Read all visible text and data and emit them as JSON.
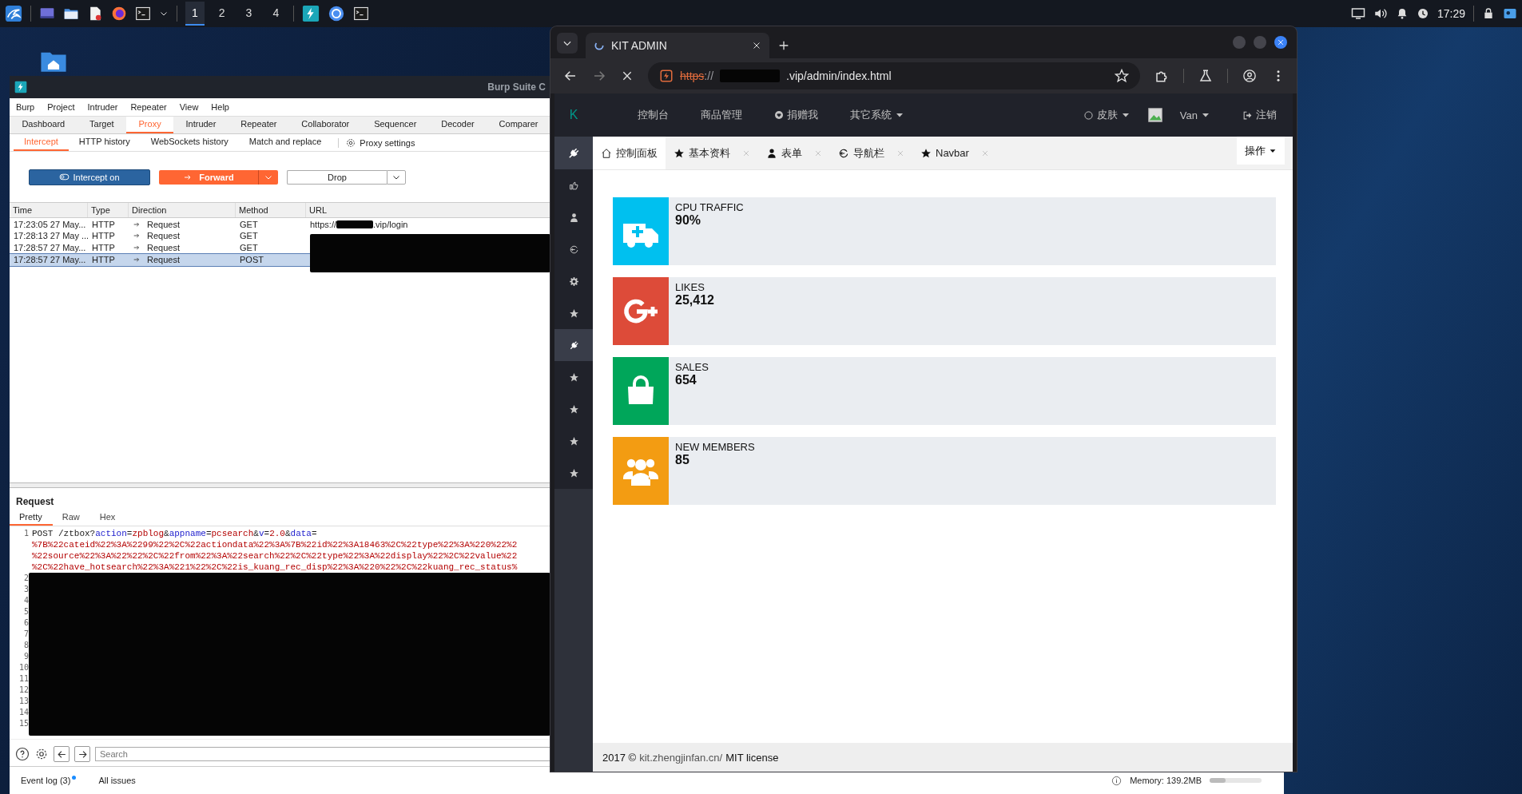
{
  "taskbar": {
    "workspaces": [
      {
        "label": "1",
        "selected": true
      },
      {
        "label": "2",
        "selected": false
      },
      {
        "label": "3",
        "selected": false
      },
      {
        "label": "4",
        "selected": false
      }
    ],
    "clock": "17:29"
  },
  "burp": {
    "title": "Burp Suite C",
    "menu": [
      "Burp",
      "Project",
      "Intruder",
      "Repeater",
      "View",
      "Help"
    ],
    "tools": [
      {
        "label": "Dashboard",
        "selected": false
      },
      {
        "label": "Target",
        "selected": false
      },
      {
        "label": "Proxy",
        "selected": true
      },
      {
        "label": "Intruder",
        "selected": false
      },
      {
        "label": "Repeater",
        "selected": false
      },
      {
        "label": "Collaborator",
        "selected": false
      },
      {
        "label": "Sequencer",
        "selected": false
      },
      {
        "label": "Decoder",
        "selected": false
      },
      {
        "label": "Comparer",
        "selected": false
      }
    ],
    "proxy_tabs": [
      {
        "label": "Intercept",
        "selected": true
      },
      {
        "label": "HTTP history",
        "selected": false
      },
      {
        "label": "WebSockets history",
        "selected": false
      },
      {
        "label": "Match and replace",
        "selected": false
      }
    ],
    "proxy_settings": "Proxy settings",
    "intercept_button": "Intercept on",
    "forward_button": "Forward",
    "drop_button": "Drop",
    "table": {
      "columns": [
        "Time",
        "Type",
        "Direction",
        "Method",
        "URL"
      ],
      "rows": [
        {
          "time": "17:23:05 27 May...",
          "type": "HTTP",
          "direction": "Request",
          "method": "GET",
          "url_prefix": "https://",
          "url_suffix": ".vip/login",
          "selected": false
        },
        {
          "time": "17:28:13 27 May ...",
          "type": "HTTP",
          "direction": "Request",
          "method": "GET",
          "selected": false
        },
        {
          "time": "17:28:57 27 May...",
          "type": "HTTP",
          "direction": "Request",
          "method": "GET",
          "selected": false
        },
        {
          "time": "17:28:57 27 May...",
          "type": "HTTP",
          "direction": "Request",
          "method": "POST",
          "selected": true
        }
      ]
    },
    "request": {
      "title": "Request",
      "tabs": [
        {
          "label": "Pretty",
          "selected": true
        },
        {
          "label": "Raw",
          "selected": false
        },
        {
          "label": "Hex",
          "selected": false
        }
      ],
      "first_line": {
        "number": "1",
        "segments": [
          {
            "text": "POST /ztbox?",
            "kind": "plain"
          },
          {
            "text": "action",
            "kind": "name"
          },
          {
            "text": "=",
            "kind": "plain"
          },
          {
            "text": "zpblog",
            "kind": "value"
          },
          {
            "text": "&",
            "kind": "plain"
          },
          {
            "text": "appname",
            "kind": "name"
          },
          {
            "text": "=",
            "kind": "plain"
          },
          {
            "text": "pcsearch",
            "kind": "value"
          },
          {
            "text": "&",
            "kind": "plain"
          },
          {
            "text": "v",
            "kind": "name"
          },
          {
            "text": "=",
            "kind": "plain"
          },
          {
            "text": "2.0",
            "kind": "value"
          },
          {
            "text": "&",
            "kind": "plain"
          },
          {
            "text": "data",
            "kind": "name"
          },
          {
            "text": "=",
            "kind": "plain"
          }
        ],
        "continuation": [
          "%7B%22cateid%22%3A%2299%22%2C%22actiondata%22%3A%7B%22id%22%3A18463%2C%22type%22%3A%220%22%2",
          "%22source%22%3A%22%22%2C%22from%22%3A%22search%22%2C%22type%22%3A%22display%22%2C%22value%22",
          "%2C%22have_hotsearch%22%3A%221%22%2C%22is_kuang_rec_disp%22%3A%220%22%2C%22kuang_rec_status%"
        ]
      },
      "line_numbers": [
        "2",
        "3",
        "4",
        "5",
        "6",
        "7",
        "8",
        "9",
        "10",
        "11",
        "12",
        "13",
        "14",
        "15"
      ],
      "search_placeholder": "Search"
    },
    "status": {
      "event_log": "Event log (3)",
      "all_issues": "All issues",
      "memory": {
        "label": "Memory: 139.2MB",
        "level": 0.3
      }
    }
  },
  "browser": {
    "tab_title": "KIT ADMIN",
    "url_scheme": "https",
    "url_separator": "://",
    "url_suffix": ".vip/admin/index.html",
    "app": {
      "logo": "K",
      "nav": [
        {
          "label": "控制台",
          "kind": "link"
        },
        {
          "label": "商品管理",
          "kind": "link"
        },
        {
          "label": "捐赠我",
          "kind": "heart"
        },
        {
          "label": "其它系统",
          "kind": "dropdown"
        }
      ],
      "skin": "皮肤",
      "user": "Van",
      "logout": "注销",
      "tabs": [
        {
          "label": "控制面板",
          "kind": "home",
          "selected": true,
          "closable": false
        },
        {
          "label": "基本资料",
          "kind": "star",
          "selected": false,
          "closable": true
        },
        {
          "label": "表单",
          "kind": "user",
          "selected": false,
          "closable": true
        },
        {
          "label": "导航栏",
          "kind": "refresh",
          "selected": false,
          "closable": true
        },
        {
          "label": "Navbar",
          "kind": "star",
          "selected": false,
          "closable": true
        }
      ],
      "actions": "操作",
      "sidebar": [
        {
          "kind": "thumbs-up",
          "selected": false
        },
        {
          "kind": "user",
          "selected": false
        },
        {
          "kind": "refresh",
          "selected": false
        },
        {
          "kind": "gear",
          "selected": false
        },
        {
          "kind": "star",
          "selected": false
        },
        {
          "kind": "plug",
          "selected": true
        },
        {
          "kind": "star",
          "selected": false
        },
        {
          "kind": "star",
          "selected": false
        },
        {
          "kind": "star",
          "selected": false
        },
        {
          "kind": "star",
          "selected": false
        }
      ],
      "cards": [
        {
          "kind": "ambulance",
          "color": "#00c0ef",
          "label": "CPU TRAFFIC",
          "value": "90%"
        },
        {
          "kind": "google-plus",
          "color": "#dd4b39",
          "label": "LIKES",
          "value": "25,412"
        },
        {
          "kind": "bag",
          "color": "#00a65a",
          "label": "SALES",
          "value": "654"
        },
        {
          "kind": "users",
          "color": "#f39c12",
          "label": "NEW MEMBERS",
          "value": "85"
        }
      ],
      "footer": {
        "year": "2017 ©",
        "link": "kit.zhengjinfan.cn/",
        "license": "MIT license"
      }
    }
  }
}
